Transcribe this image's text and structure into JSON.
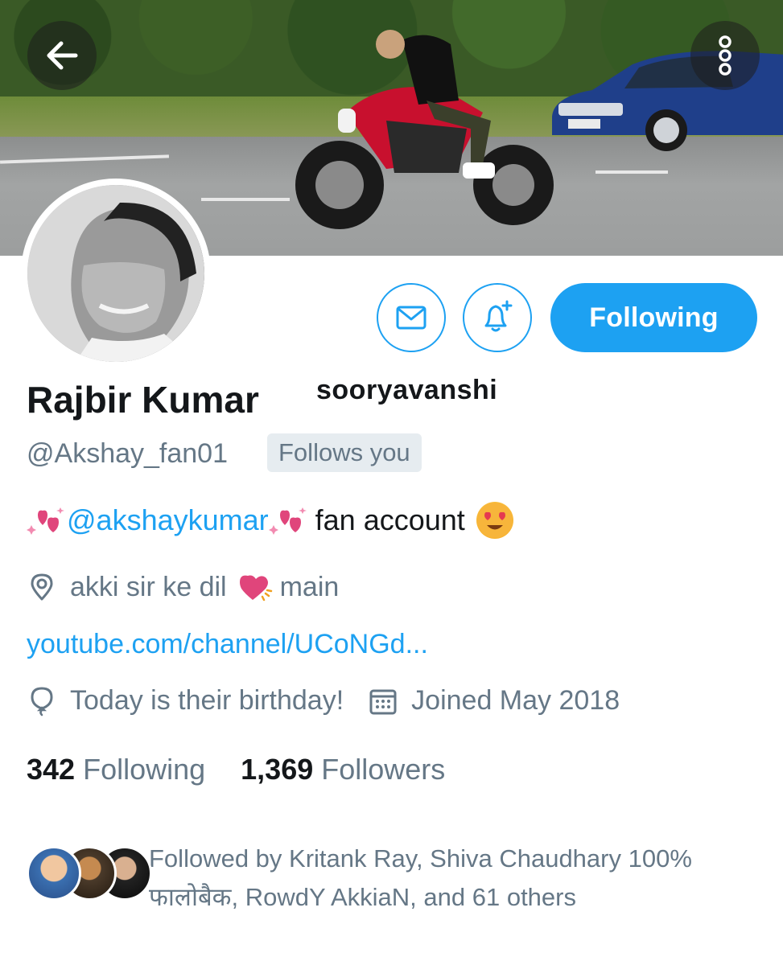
{
  "profile": {
    "name": "Rajbir Kumar",
    "name_suffix": "sooryavanshi",
    "handle": "@Akshay_fan01",
    "follows_you": "Follows you",
    "bio_mention": "@akshaykumar",
    "bio_text": "fan account",
    "location_prefix": "akki sir ke dil",
    "location_suffix": "main",
    "website": "youtube.com/channel/UCoNGd...",
    "birthday": "Today is their birthday!",
    "joined": "Joined May 2018"
  },
  "actions": {
    "follow_label": "Following"
  },
  "stats": {
    "following_count": "342",
    "following_label": "Following",
    "followers_count": "1,369",
    "followers_label": "Followers"
  },
  "followed_by": {
    "text": "Followed by Kritank Ray, Shiva Chaudhary 100% फालोबैक, RowdY AkkiaN, and 61 others"
  },
  "colors": {
    "accent": "#1da1f2",
    "secondary_text": "#657786",
    "primary_text": "#14171a"
  },
  "icons": [
    "back-arrow-icon",
    "more-vertical-icon",
    "mail-icon",
    "bell-plus-icon",
    "location-pin-icon",
    "balloon-icon",
    "calendar-icon",
    "sparkling-hearts-emoji",
    "heart-eyes-emoji",
    "beating-heart-emoji"
  ]
}
